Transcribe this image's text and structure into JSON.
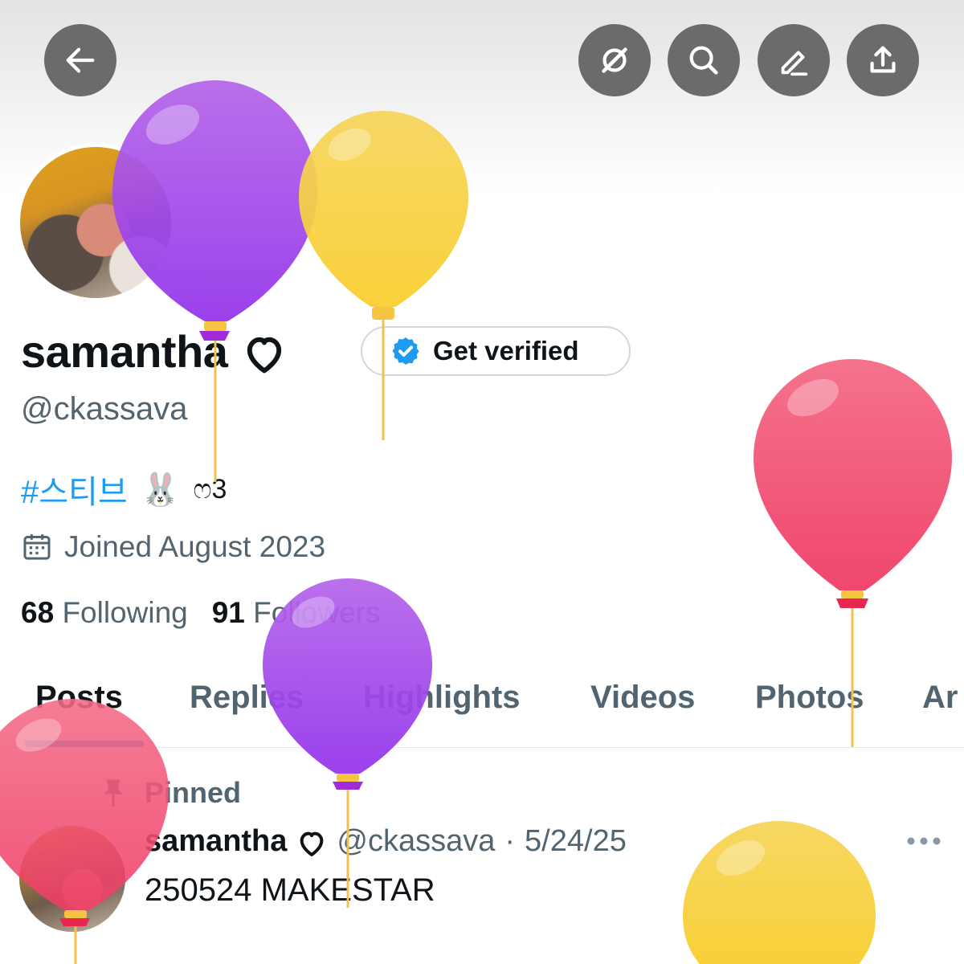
{
  "header": {
    "back_icon": "arrow-left-icon",
    "actions": [
      "grok-icon",
      "search-icon",
      "edit-icon",
      "share-icon"
    ]
  },
  "profile": {
    "display_name": "samantha",
    "name_emoji": "heart-outline-icon",
    "verify_label": "Get verified",
    "handle": "@ckassava",
    "bio_hashtag": "#스티브",
    "bio_emoji": "🐰",
    "bio_suffix": "ෆ3",
    "joined": "Joined August 2023",
    "following_count": "68",
    "following_label": "Following",
    "followers_count": "91",
    "followers_label": "Followers"
  },
  "tabs": [
    "Posts",
    "Replies",
    "Highlights",
    "Videos",
    "Photos",
    "Ar"
  ],
  "post": {
    "pinned_label": "Pinned",
    "author_name": "samantha",
    "handle": "@ckassava",
    "separator": "·",
    "date": "5/24/25",
    "text": "250524 MAKESTAR"
  },
  "colors": {
    "accent": "#1d9bf0",
    "text": "#0f1419",
    "muted": "#536471",
    "balloon_purple": "#a855f7",
    "balloon_yellow": "#f7d44c",
    "balloon_pink": "#f0506e"
  }
}
